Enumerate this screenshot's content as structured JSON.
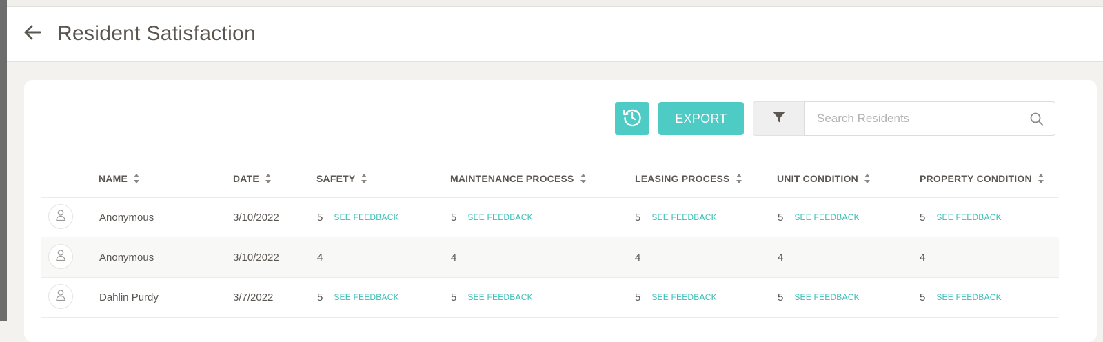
{
  "header": {
    "title": "Resident Satisfaction"
  },
  "toolbar": {
    "export_label": "EXPORT"
  },
  "search": {
    "placeholder": "Search Residents"
  },
  "colors": {
    "accent": "#4ecbc4",
    "link": "#3cbfb7",
    "text": "#5a5652"
  },
  "icons": {
    "back": "arrow-left-icon",
    "history": "history-icon",
    "filter": "filter-icon",
    "search": "search-icon",
    "avatar": "user-icon",
    "sort": "sort-icon"
  },
  "table": {
    "columns": [
      "NAME",
      "DATE",
      "SAFETY",
      "MAINTENANCE PROCESS",
      "LEASING PROCESS",
      "UNIT CONDITION",
      "PROPERTY CONDITION"
    ],
    "feedback_label": "SEE FEEDBACK",
    "rows": [
      {
        "name": "Anonymous",
        "date": "3/10/2022",
        "scores": [
          "5",
          "5",
          "5",
          "5",
          "5"
        ],
        "feedback": [
          true,
          true,
          true,
          true,
          true
        ]
      },
      {
        "name": "Anonymous",
        "date": "3/10/2022",
        "scores": [
          "4",
          "4",
          "4",
          "4",
          "4"
        ],
        "feedback": [
          false,
          false,
          false,
          false,
          false
        ]
      },
      {
        "name": "Dahlin Purdy",
        "date": "3/7/2022",
        "scores": [
          "5",
          "5",
          "5",
          "5",
          "5"
        ],
        "feedback": [
          true,
          true,
          true,
          true,
          true
        ]
      }
    ]
  }
}
